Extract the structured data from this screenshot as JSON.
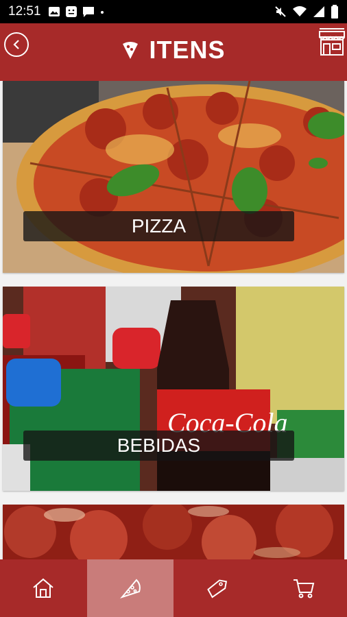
{
  "status_bar": {
    "time": "12:51",
    "icons": [
      "image-icon",
      "face-icon",
      "message-icon",
      "dot-icon"
    ],
    "right_icons": [
      "mute-icon",
      "wifi-icon",
      "signal-icon",
      "battery-icon"
    ]
  },
  "app_bar": {
    "title": "ITENS",
    "title_icon": "pizza-slice-icon",
    "back_icon": "back-icon",
    "store_icon": "store-icon",
    "background_color": "#a72a29"
  },
  "categories": [
    {
      "label": "PIZZA",
      "image": "pizza-photo"
    },
    {
      "label": "BEBIDAS",
      "image": "drinks-photo"
    },
    {
      "label": "",
      "image": "pepperoni-photo"
    }
  ],
  "bottom_nav": {
    "items": [
      {
        "icon": "home-icon",
        "active": false
      },
      {
        "icon": "pizza-slice-icon",
        "active": true
      },
      {
        "icon": "tag-icon",
        "active": false
      },
      {
        "icon": "cart-icon",
        "active": false
      }
    ]
  }
}
